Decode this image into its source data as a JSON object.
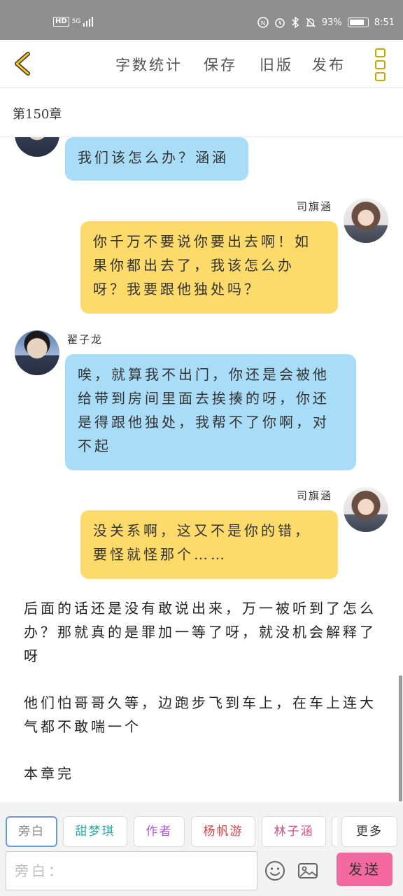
{
  "status_bar": {
    "hd": "HD",
    "network": "5G",
    "battery_percent": "93%",
    "time": "8:51"
  },
  "toolbar": {
    "word_count": "字数统计",
    "save": "保存",
    "old_version": "旧版",
    "publish": "发布"
  },
  "chapter": {
    "title": "第150章"
  },
  "messages": [
    {
      "speaker": "",
      "side": "left",
      "text": "我们该怎么办？涵涵"
    },
    {
      "speaker": "司旗涵",
      "side": "right",
      "text": "你千万不要说你要出去啊！如果你都出去了，我该怎么办呀？我要跟他独处吗？"
    },
    {
      "speaker": "翟子龙",
      "side": "left",
      "text": "唉，就算我不出门，你还是会被他给带到房间里面去挨揍的呀，你还是得跟他独处，我帮不了你啊，对不起"
    },
    {
      "speaker": "司旗涵",
      "side": "right",
      "text": "没关系啊，这又不是你的错，要怪就怪那个……"
    }
  ],
  "narration": [
    "后面的话还是没有敢说出来，万一被听到了怎么办？那就真的是罪加一等了呀，就没机会解释了呀",
    "他们怕哥哥久等，边跑步飞到车上，在车上连大气都不敢喘一个",
    "本章完"
  ],
  "roles": [
    {
      "label": "旁白",
      "color": "#888888"
    },
    {
      "label": "甜梦琪",
      "color": "#2aa6a6"
    },
    {
      "label": "作者",
      "color": "#b05ad0"
    },
    {
      "label": "杨帆游",
      "color": "#d04040"
    },
    {
      "label": "林子涵",
      "color": "#d0508a"
    },
    {
      "label": "更多",
      "color": "#333333"
    }
  ],
  "input": {
    "placeholder": "旁白：",
    "value": ""
  },
  "send_button": "发送"
}
